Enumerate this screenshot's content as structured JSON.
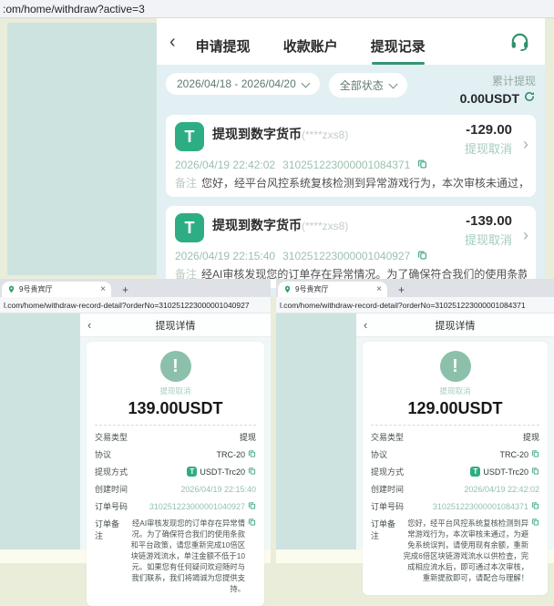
{
  "browser_url": ":om/home/withdraw?active=3",
  "icons": {
    "back": "‹",
    "forward": "›",
    "close": "×",
    "new_tab": "+",
    "tether_letter": "T",
    "warning": "!"
  },
  "colors": {
    "accent_green": "#2e9069",
    "tether_green": "#2ead84",
    "status_light_green": "#a3ccba",
    "teal_panel": "#cde3e0",
    "content_blue": "#e2f0f3"
  },
  "main": {
    "tabs": [
      "申请提现",
      "收款账户",
      "提现记录"
    ],
    "active_tab": "提现记录",
    "filters": {
      "date_range": "2026/04/18 - 2026/04/20",
      "status": "全部状态"
    },
    "summary": {
      "label": "累计提现",
      "value": "0.00USDT"
    },
    "records": [
      {
        "title": "提现到数字货币",
        "account": "(****zxs8)",
        "amount": "-129.00",
        "status": "提现取消",
        "datetime": "2026/04/19 22:42:02",
        "order_no": "310251223000001084371",
        "remark_label": "备注",
        "remark": "您好，经平台风控系统复核检测到异常游戏行为，本次审核未通过，为..."
      },
      {
        "title": "提现到数字货币",
        "account": "(****zxs8)",
        "amount": "-139.00",
        "status": "提现取消",
        "datetime": "2026/04/19 22:15:40",
        "order_no": "310251223000001040927",
        "remark_label": "备注",
        "remark": "经AI审核发现您的订单存在异常情况。为了确保符合我们的使用条款和..."
      }
    ]
  },
  "windows": [
    {
      "tab_title": "9号贵宾厅",
      "url": "l.com/home/withdraw-record-detail?orderNo=310251223000001040927",
      "page_title": "提现详情",
      "status": "提现取消",
      "amount": "139.00USDT",
      "rows": [
        {
          "label": "交易类型",
          "value": "提现"
        },
        {
          "label": "协议",
          "value": "TRC-20"
        },
        {
          "label": "提现方式",
          "value": "USDT-Trc20"
        },
        {
          "label": "创建时间",
          "value": "2026/04/19 22:15:40"
        },
        {
          "label": "订单号码",
          "value": "310251223000001040927"
        }
      ],
      "remark_label": "订单备注",
      "remark": "经AI审核发现您的订单存在异常情况。为了确保符合我们的使用条款和平台政策，请您重新完成10倍区块链游戏流水，单注金额不低于10元。如果您有任何疑问欢迎随时与我们联系，我们将竭诚为您提供支持。"
    },
    {
      "tab_title": "9号贵宾厅",
      "url": "l.com/home/withdraw-record-detail?orderNo=310251223000001084371",
      "page_title": "提现详情",
      "status": "提现取消",
      "amount": "129.00USDT",
      "rows": [
        {
          "label": "交易类型",
          "value": "提现"
        },
        {
          "label": "协议",
          "value": "TRC-20"
        },
        {
          "label": "提现方式",
          "value": "USDT-Trc20"
        },
        {
          "label": "创建时间",
          "value": "2026/04/19 22:42:02"
        },
        {
          "label": "订单号码",
          "value": "310251223000001084371"
        }
      ],
      "remark_label": "订单备注",
      "remark": "您好，经平台风控系统复核检测到异常游戏行为，本次审核未通过，为避免系统误判，请使用现有余额，重新完成6倍区块链游戏流水以供检查，完成相应流水后，即可通过本次审核，重新提款即可，请配合与理解！"
    }
  ]
}
